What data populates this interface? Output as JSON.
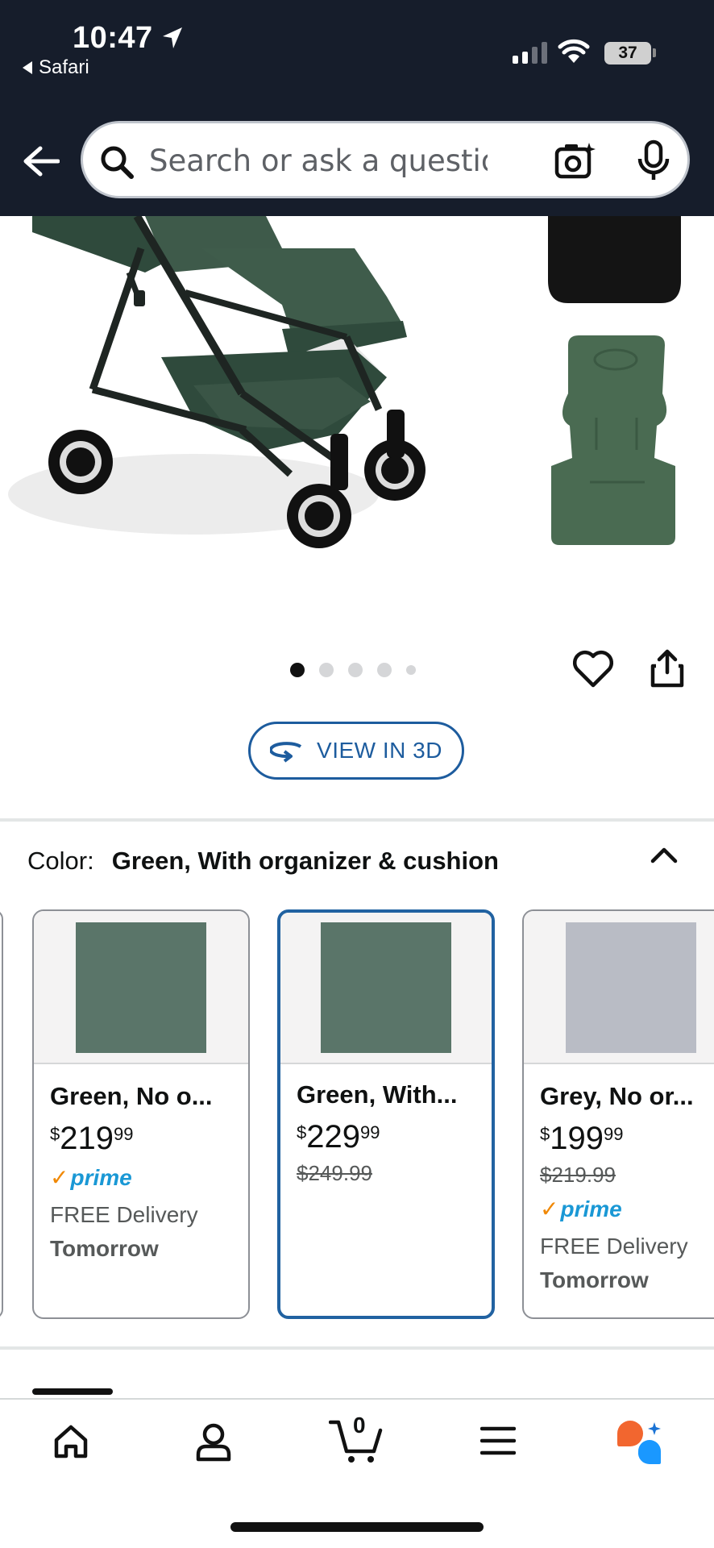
{
  "status_bar": {
    "time": "10:47",
    "back_app": "Safari",
    "battery": "37"
  },
  "search": {
    "placeholder": "Search or ask a question"
  },
  "gallery": {
    "page_count": 5,
    "active_index": 0
  },
  "view_3d": {
    "label": "VIEW IN 3D"
  },
  "color_selector": {
    "label": "Color:",
    "value": "Green, With organizer & cushion"
  },
  "swatches": [
    {
      "name": "Green, No o...",
      "price_symbol": "$",
      "price_whole": "219",
      "price_fraction": "99",
      "list_price": "",
      "prime": "prime",
      "delivery": "FREE Delivery",
      "delivery_day": "Tomorrow",
      "color": "#5a7569"
    },
    {
      "name": "Green, With...",
      "price_symbol": "$",
      "price_whole": "229",
      "price_fraction": "99",
      "list_price": "$249.99",
      "prime": "",
      "delivery": "",
      "delivery_day": "",
      "color": "#5a7569"
    },
    {
      "name": "Grey, No or...",
      "price_symbol": "$",
      "price_whole": "199",
      "price_fraction": "99",
      "list_price": "$219.99",
      "prime": "prime",
      "delivery": "FREE Delivery",
      "delivery_day": "Tomorrow",
      "color": "#b9bcc5"
    }
  ],
  "cart": {
    "count": "0"
  },
  "colors": {
    "header_bg": "#161d2b",
    "accent_blue": "#1d5c9e",
    "prime_blue": "#1a98d5",
    "prime_check": "#f08804",
    "stroller_green": "#3e5a4a"
  },
  "icons": [
    "location-arrow-icon",
    "signal-icon",
    "wifi-icon",
    "battery-icon",
    "back-arrow-icon",
    "search-icon",
    "camera-icon",
    "mic-icon",
    "heart-icon",
    "share-icon",
    "rotate-3d-icon",
    "chevron-up-icon",
    "home-icon",
    "account-icon",
    "cart-icon",
    "menu-icon",
    "rufus-icon"
  ]
}
